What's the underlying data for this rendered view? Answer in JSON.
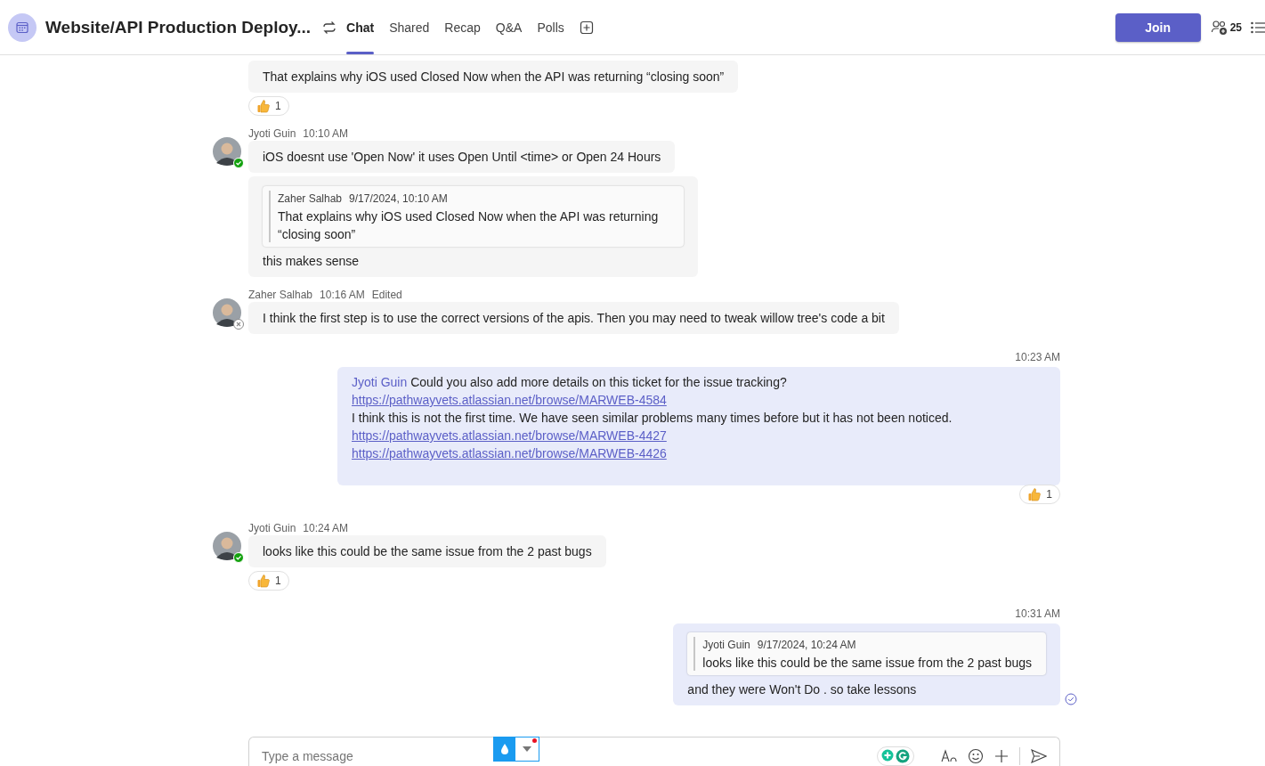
{
  "header": {
    "title": "Website/API Production Deploy...",
    "tabs": [
      {
        "label": "Chat",
        "selected": true,
        "kind": "chat"
      },
      {
        "label": "Shared",
        "selected": false
      },
      {
        "label": "Recap",
        "selected": false
      },
      {
        "label": "Q&A",
        "selected": false
      },
      {
        "label": "Polls",
        "selected": false
      }
    ],
    "join_button": "Join",
    "participants": "25"
  },
  "messages": [
    {
      "kind": "other",
      "bubbles": [
        {
          "text": "That explains why iOS used Closed Now when the API was returning “closing soon”"
        }
      ],
      "reaction": {
        "count": "1"
      }
    },
    {
      "kind": "other",
      "author": "Jyoti Guin",
      "time": "10:10 AM",
      "online": true,
      "bubbles": [
        {
          "text": "iOS doesnt use 'Open Now' it uses Open Until <time> or Open 24 Hours"
        },
        {
          "quote": {
            "author": "Zaher Salhab",
            "time": "9/17/2024, 10:10 AM",
            "text": "That explains why iOS used Closed Now when the API was returning “closing soon”"
          },
          "text": "this makes sense"
        }
      ]
    },
    {
      "kind": "other",
      "author": "Zaher Salhab",
      "time": "10:16 AM",
      "edited": "Edited",
      "online": false,
      "bubbles": [
        {
          "text": "I think the first step is to use the correct versions of the apis. Then you may need to tweak willow tree's code a bit"
        }
      ]
    },
    {
      "kind": "own",
      "time": "10:23 AM",
      "lines": [
        {
          "kind": "mention",
          "mention": "Jyoti Guin",
          "text": "Could you also add more details on this ticket for the issue tracking?"
        },
        {
          "kind": "link",
          "text": "https://pathwayvets.atlassian.net/browse/MARWEB-4584"
        },
        {
          "kind": "text",
          "text": "I think this is not the first time. We have seen similar problems many times before but it has not been noticed."
        },
        {
          "kind": "link",
          "text": "https://pathwayvets.atlassian.net/browse/MARWEB-4427"
        },
        {
          "kind": "link",
          "text": "https://pathwayvets.atlassian.net/browse/MARWEB-4426"
        }
      ],
      "reaction": {
        "count": "1"
      }
    },
    {
      "kind": "other",
      "author": "Jyoti Guin",
      "time": "10:24 AM",
      "online": true,
      "bubbles": [
        {
          "text": "looks like this could be the same issue from the 2 past bugs"
        }
      ],
      "reaction": {
        "count": "1"
      }
    },
    {
      "kind": "own",
      "time": "10:31 AM",
      "quote": {
        "author": "Jyoti Guin",
        "time": "9/17/2024, 10:24 AM",
        "text": "looks like this could be the same issue from the 2 past bugs"
      },
      "lines": [
        {
          "kind": "text",
          "text": "and they were Won't Do . so take lessons"
        }
      ],
      "seen": true
    }
  ],
  "composer": {
    "placeholder": "Type a message"
  }
}
